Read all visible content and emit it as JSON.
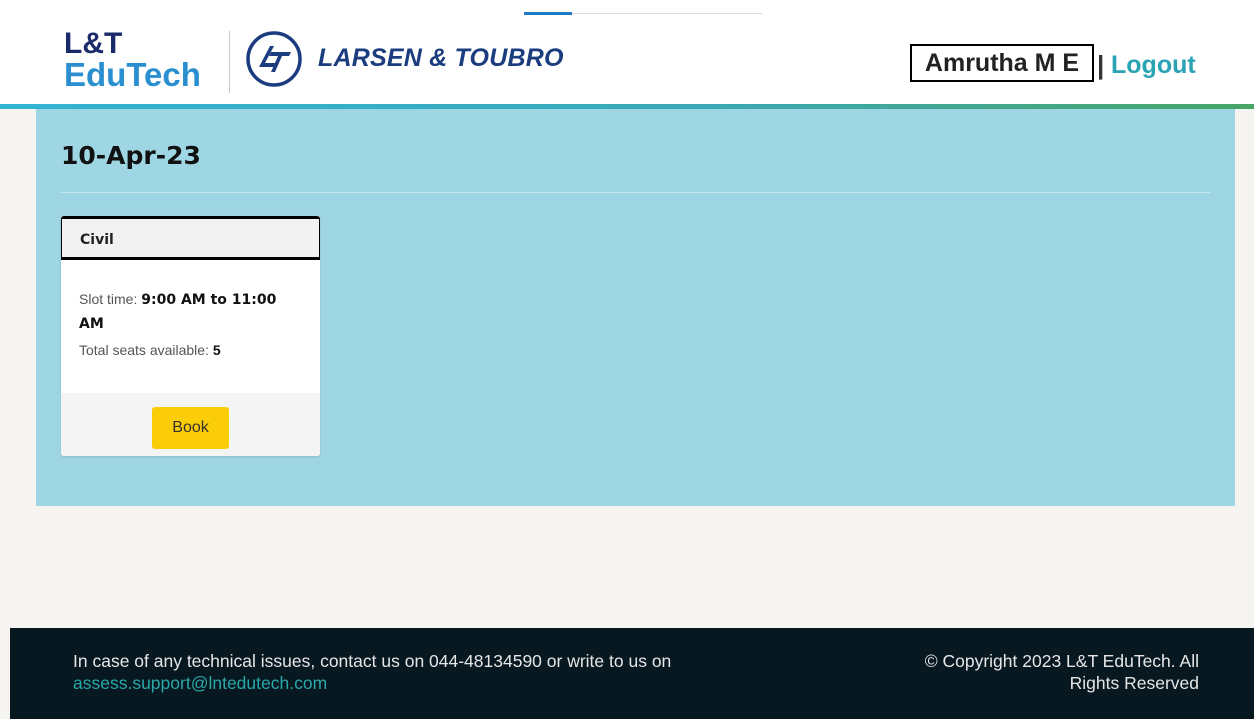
{
  "header": {
    "logo_line1": "L&T",
    "logo_line2": "EduTech",
    "brand_text": "LARSEN & TOUBRO",
    "user_name": "Amrutha M E",
    "separator": "|",
    "logout_label": "Logout",
    "colors": {
      "accent": "#2aa4b5",
      "brand_navy": "#1b2a6b",
      "brand_blue": "#2a8fd0"
    }
  },
  "main": {
    "date": "10-Apr-23",
    "panel_color": "#9fd6e4",
    "slots": [
      {
        "title": "Civil",
        "slot_time_label": "Slot time:",
        "slot_time_value": "9:00 AM to 11:00 AM",
        "seats_label": "Total seats available:",
        "seats_value": "5",
        "book_label": "Book",
        "button_color": "#fbcc08"
      }
    ]
  },
  "footer": {
    "support_text": "In case of any technical issues, contact us on 044-48134590 or write to us on",
    "support_email": "assess.support@lntedutech.com",
    "copyright_line1": "© Copyright 2023 L&T EduTech. All",
    "copyright_line2": "Rights Reserved"
  },
  "icons": [
    "lt-logo-icon"
  ]
}
